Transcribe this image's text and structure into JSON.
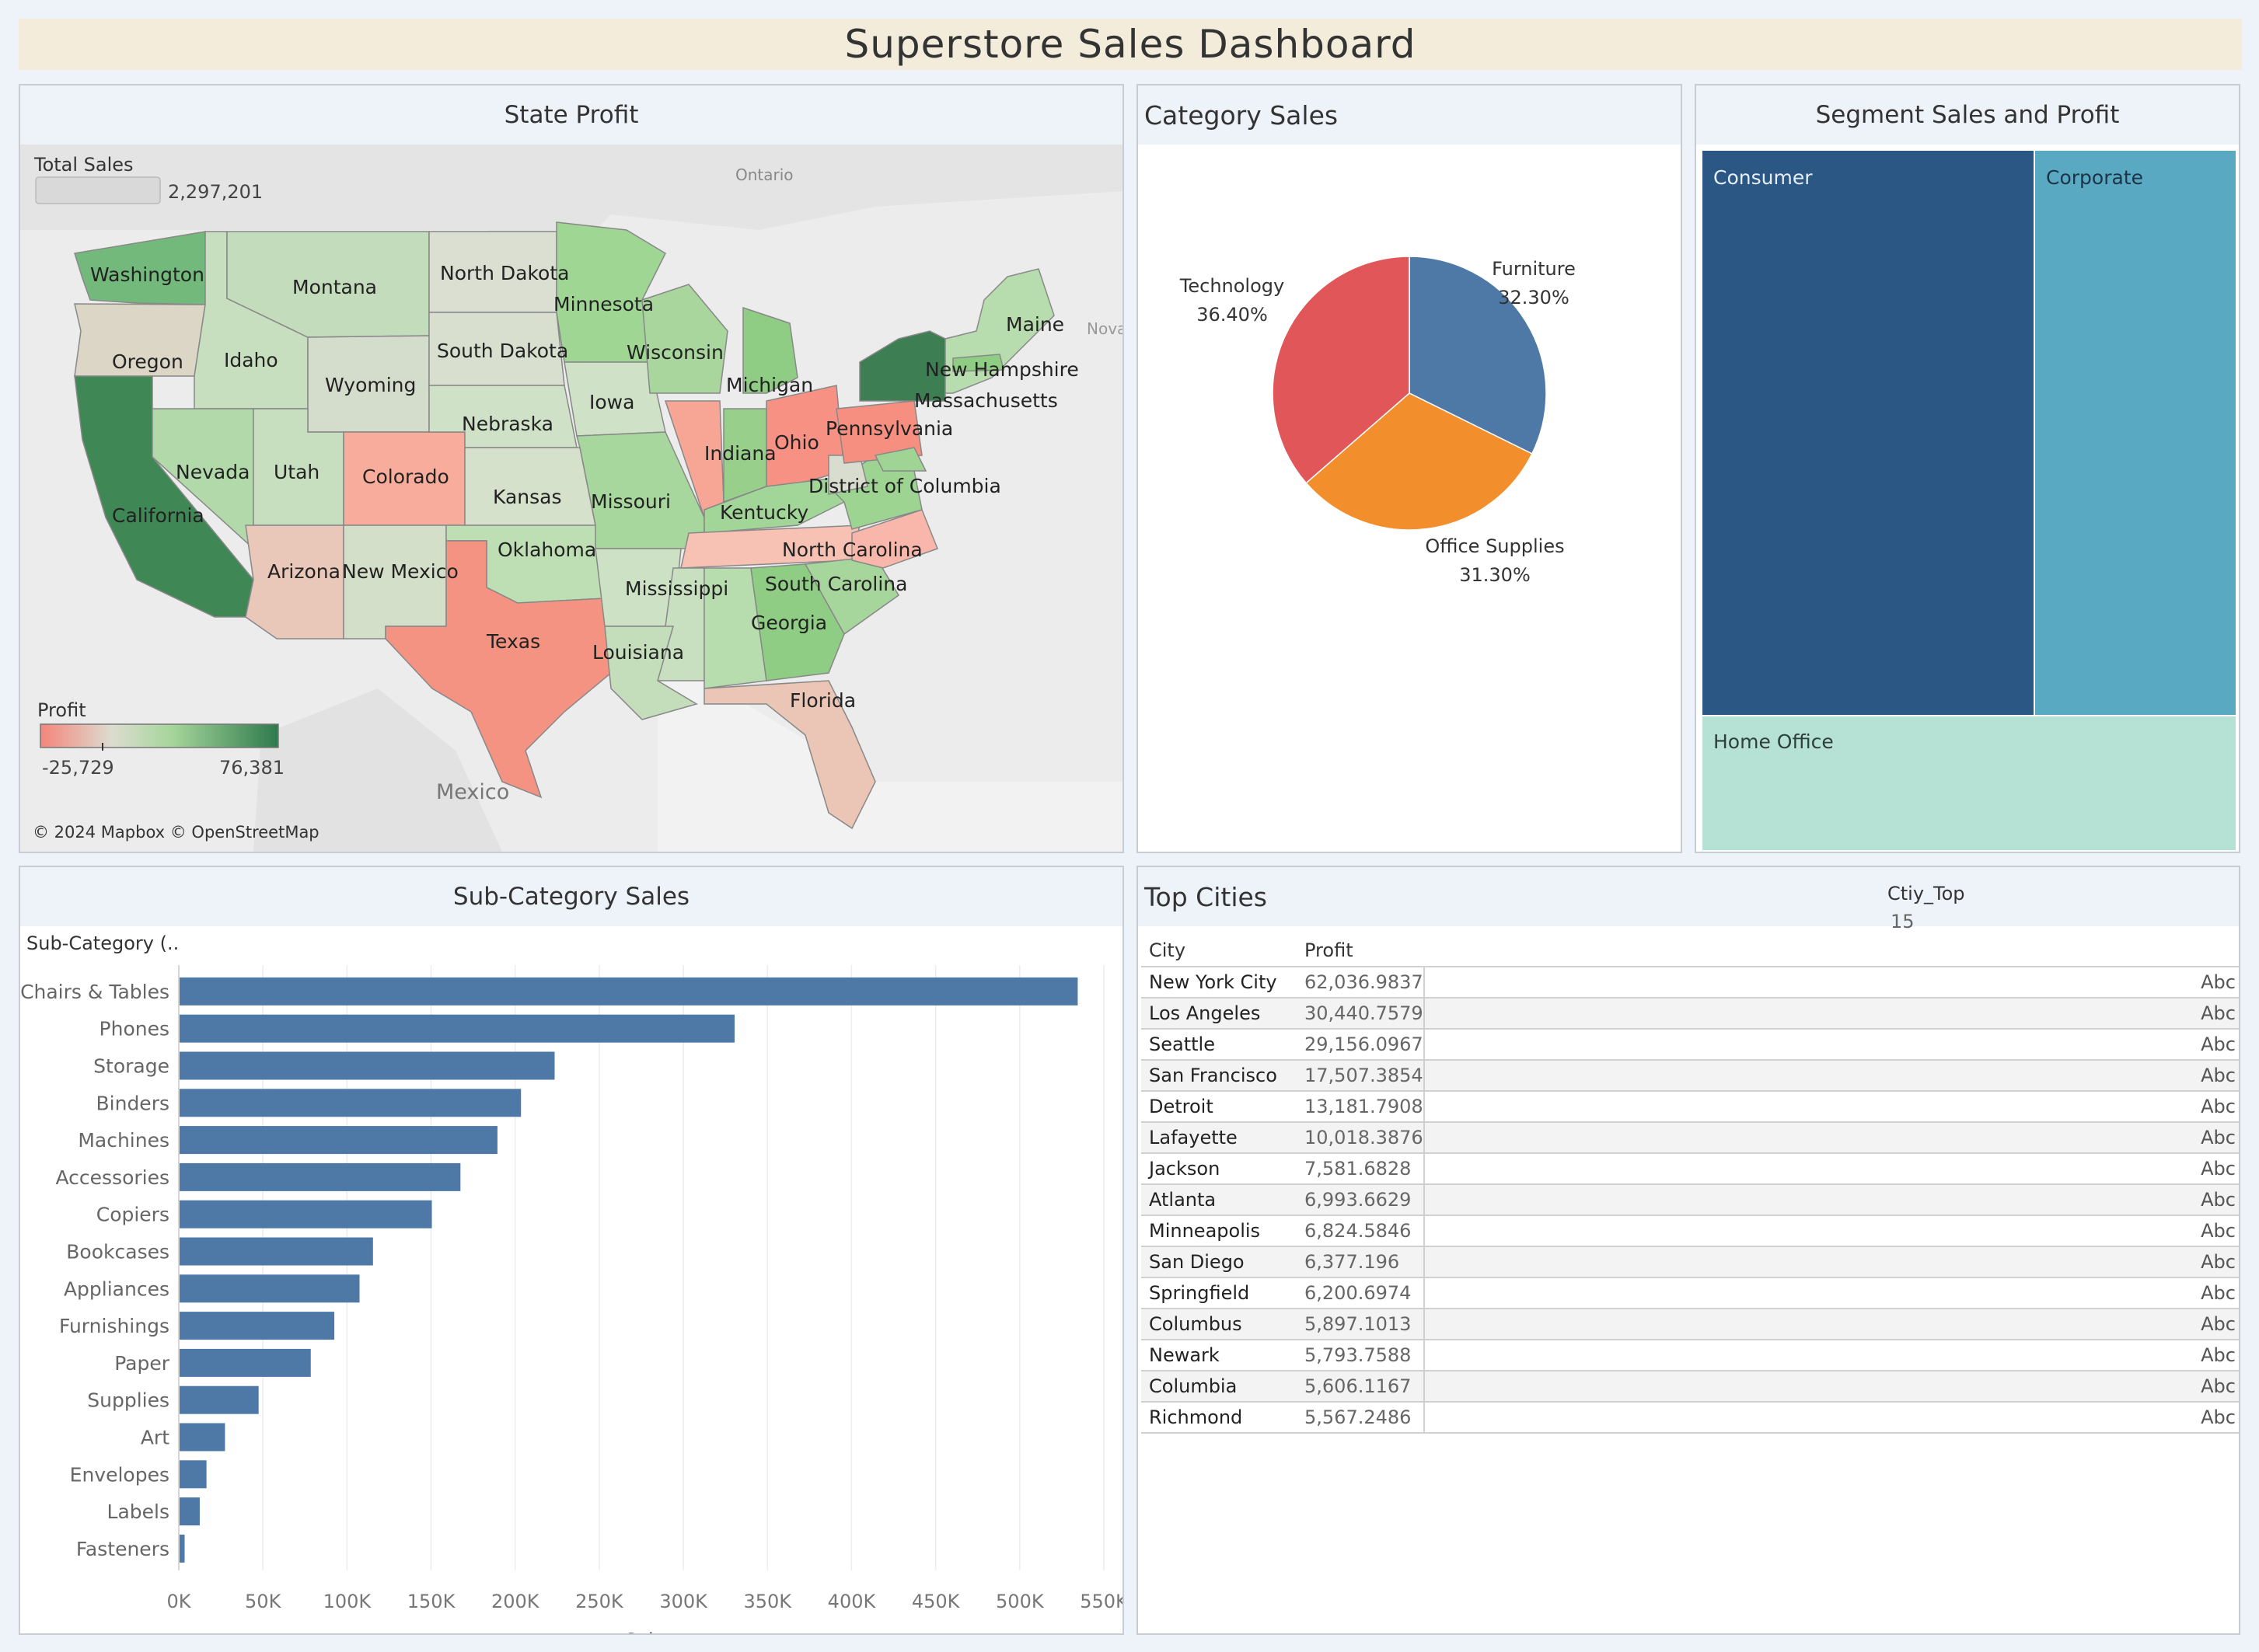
{
  "header": {
    "title": "Superstore Sales Dashboard"
  },
  "state_profit": {
    "title": "State Profit",
    "total_sales_label": "Total Sales",
    "total_sales_value": "2,297,201",
    "legend_title": "Profit",
    "legend_min": "-25,729",
    "legend_max": "76,381",
    "attribution": "© 2024 Mapbox © OpenStreetMap",
    "basemap_labels": {
      "ontario": "Ontario",
      "mexico": "Mexico",
      "nova": "Nova"
    },
    "states": {
      "washington": "Washington",
      "oregon": "Oregon",
      "california": "California",
      "idaho": "Idaho",
      "montana": "Montana",
      "wyoming": "Wyoming",
      "nevada": "Nevada",
      "utah": "Utah",
      "colorado": "Colorado",
      "arizona": "Arizona",
      "new_mexico": "New Mexico",
      "north_dakota": "North Dakota",
      "south_dakota": "South Dakota",
      "nebraska": "Nebraska",
      "kansas": "Kansas",
      "oklahoma": "Oklahoma",
      "texas": "Texas",
      "minnesota": "Minnesota",
      "iowa": "Iowa",
      "missouri": "Missouri",
      "wisconsin": "Wisconsin",
      "michigan": "Michigan",
      "indiana": "Indiana",
      "ohio": "Ohio",
      "kentucky": "Kentucky",
      "mississippi": "Mississippi",
      "louisiana": "Louisiana",
      "georgia": "Georgia",
      "florida": "Florida",
      "south_carolina": "South Carolina",
      "north_carolina": "North Carolina",
      "pennsylvania": "Pennsylvania",
      "dc": "District of Columbia",
      "new_hampshire": "New Hampshire",
      "massachusetts": "Massachusetts",
      "maine": "Maine"
    },
    "colors": {
      "negative": "#f4857a",
      "neutral": "#dcdcd0",
      "positive": "#2e7a4c"
    }
  },
  "category_sales": {
    "title": "Category Sales",
    "slices": [
      {
        "name": "Furniture",
        "pct_label": "32.30%",
        "value": 32.3,
        "color": "#4e79a7"
      },
      {
        "name": "Office Supplies",
        "pct_label": "31.30%",
        "value": 31.3,
        "color": "#f28e2b"
      },
      {
        "name": "Technology",
        "pct_label": "36.40%",
        "value": 36.4,
        "color": "#e15759"
      }
    ]
  },
  "segment": {
    "title": "Segment Sales and Profit",
    "consumer": "Consumer",
    "corporate": "Corporate",
    "home_office": "Home Office",
    "colors": {
      "consumer": "#2a5783",
      "corporate": "#59a9c2",
      "home_office": "#b5e2d5"
    }
  },
  "subcategory": {
    "title": "Sub-Category Sales",
    "header": "Sub-Category (..",
    "xlabel": "Sales",
    "ticks": [
      "0K",
      "50K",
      "100K",
      "150K",
      "200K",
      "250K",
      "300K",
      "350K",
      "400K",
      "450K",
      "500K",
      "550K"
    ],
    "bar_color": "#4e79a7"
  },
  "chart_data": {
    "type": "bar",
    "orientation": "horizontal",
    "title": "Sub-Category Sales",
    "xlabel": "Sales",
    "ylabel": "Sub-Category (..",
    "xlim": [
      0,
      550000
    ],
    "categories": [
      "Chairs & Tables",
      "Phones",
      "Storage",
      "Binders",
      "Machines",
      "Accessories",
      "Copiers",
      "Bookcases",
      "Appliances",
      "Furnishings",
      "Paper",
      "Supplies",
      "Art",
      "Envelopes",
      "Labels",
      "Fasteners"
    ],
    "values": [
      534000,
      330000,
      223000,
      203000,
      189000,
      167000,
      150000,
      115000,
      107000,
      92000,
      78000,
      47000,
      27000,
      16000,
      12000,
      3000
    ]
  },
  "top_cities": {
    "title": "Top Cities",
    "param_label": "Ctiy_Top",
    "param_value": "15",
    "col_city": "City",
    "col_profit": "Profit",
    "abc": "Abc",
    "rows": [
      {
        "city": "New York City",
        "profit": "62,036.9837"
      },
      {
        "city": "Los Angeles",
        "profit": "30,440.7579"
      },
      {
        "city": "Seattle",
        "profit": "29,156.0967"
      },
      {
        "city": "San Francisco",
        "profit": "17,507.3854"
      },
      {
        "city": "Detroit",
        "profit": "13,181.7908"
      },
      {
        "city": "Lafayette",
        "profit": "10,018.3876"
      },
      {
        "city": "Jackson",
        "profit": "7,581.6828"
      },
      {
        "city": "Atlanta",
        "profit": "6,993.6629"
      },
      {
        "city": "Minneapolis",
        "profit": "6,824.5846"
      },
      {
        "city": "San Diego",
        "profit": "6,377.196"
      },
      {
        "city": "Springfield",
        "profit": "6,200.6974"
      },
      {
        "city": "Columbus",
        "profit": "5,897.1013"
      },
      {
        "city": "Newark",
        "profit": "5,793.7588"
      },
      {
        "city": "Columbia",
        "profit": "5,606.1167"
      },
      {
        "city": "Richmond",
        "profit": "5,567.2486"
      }
    ]
  }
}
